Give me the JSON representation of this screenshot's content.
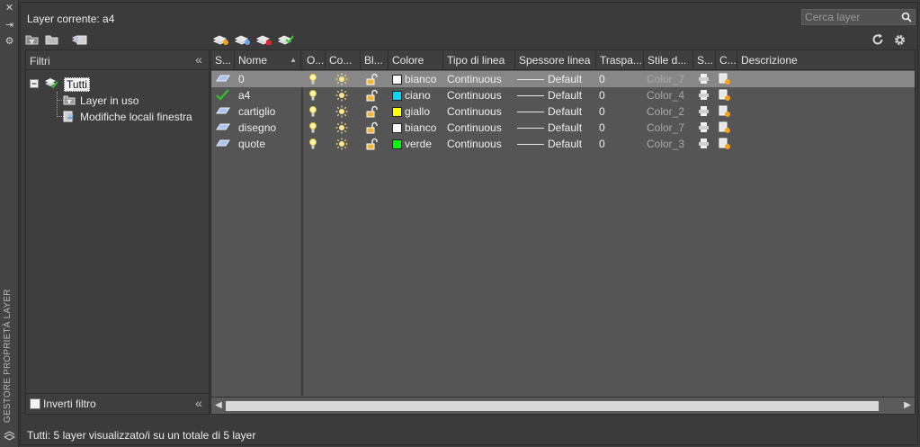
{
  "palette_title": "GESTORE PROPRIETÀ LAYER",
  "current_layer_title": "Layer corrente: a4",
  "search": {
    "placeholder": "Cerca layer"
  },
  "filters": {
    "header": "Filtri",
    "tree": [
      {
        "label": "Tutti",
        "selected": true,
        "icon": "layers-stack-icon"
      },
      {
        "label": "Layer in uso",
        "icon": "layers-in-use-filter-icon"
      },
      {
        "label": "Modifiche locali finestra",
        "icon": "viewport-overrides-icon"
      }
    ],
    "invert_label": "Inverti filtro",
    "invert_checked": false
  },
  "columns": [
    "S...",
    "Nome",
    "O...",
    "Co...",
    "Bl...",
    "Colore",
    "Tipo di linea",
    "Spessore linea",
    "Traspa...",
    "Stile d...",
    "S...",
    "C...",
    "Descrizione"
  ],
  "layers": [
    {
      "status_icon": "layer-icon",
      "name": "0",
      "color_name": "bianco",
      "color_hex": "#ffffff",
      "linetype": "Continuous",
      "lineweight": "Default",
      "transparency": "0",
      "plot_style": "Color_7",
      "selected": true
    },
    {
      "status_icon": "current-layer-check-icon",
      "name": "a4",
      "color_name": "ciano",
      "color_hex": "#00d5ff",
      "linetype": "Continuous",
      "lineweight": "Default",
      "transparency": "0",
      "plot_style": "Color_4",
      "selected": false
    },
    {
      "status_icon": "layer-icon",
      "name": "cartiglio",
      "color_name": "giallo",
      "color_hex": "#ffff00",
      "linetype": "Continuous",
      "lineweight": "Default",
      "transparency": "0",
      "plot_style": "Color_2",
      "selected": false
    },
    {
      "status_icon": "layer-icon",
      "name": "disegno",
      "color_name": "bianco",
      "color_hex": "#ffffff",
      "linetype": "Continuous",
      "lineweight": "Default",
      "transparency": "0",
      "plot_style": "Color_7",
      "selected": false
    },
    {
      "status_icon": "layer-icon",
      "name": "quote",
      "color_name": "verde",
      "color_hex": "#00ff00",
      "linetype": "Continuous",
      "lineweight": "Default",
      "transparency": "0",
      "plot_style": "Color_3",
      "selected": false
    }
  ],
  "row_icons": {
    "on": "lightbulb-on-icon",
    "freeze": "sun-thawed-icon",
    "lock": "padlock-unlocked-icon",
    "plot": "printer-icon",
    "new_vp_freeze": "new-viewport-freeze-icon"
  },
  "status_text": "Tutti: 5 layer visualizzato/i su un totale di 5 layer",
  "accent_colors": {
    "background": "#3b3b3b",
    "grid": "#555555",
    "selected_row": "#878787"
  }
}
